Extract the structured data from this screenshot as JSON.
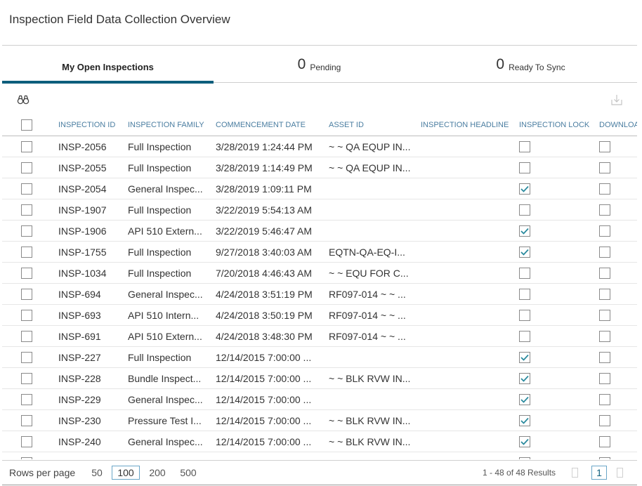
{
  "page": {
    "title": "Inspection Field Data Collection Overview"
  },
  "tabs": {
    "my_open": {
      "label": "My Open Inspections"
    },
    "pending": {
      "count": "0",
      "label": "Pending"
    },
    "ready": {
      "count": "0",
      "label": "Ready To Sync"
    }
  },
  "toolbar": {
    "search_icon": "binoculars-icon",
    "download_icon": "download-icon"
  },
  "columns": {
    "id": "INSPECTION ID",
    "family": "INSPECTION FAMILY",
    "date": "COMMENCEMENT DATE",
    "asset": "ASSET ID",
    "headline": "INSPECTION HEADLINE",
    "lock": "INSPECTION LOCK",
    "download": "DOWNLOA"
  },
  "rows": [
    {
      "id": "INSP-2056",
      "family": "Full Inspection",
      "date": "3/28/2019 1:24:44 PM",
      "asset": "~ ~ QA EQUP IN...",
      "headline": "",
      "lock": false,
      "download": false
    },
    {
      "id": "INSP-2055",
      "family": "Full Inspection",
      "date": "3/28/2019 1:14:49 PM",
      "asset": "~ ~ QA EQUP IN...",
      "headline": "",
      "lock": false,
      "download": false
    },
    {
      "id": "INSP-2054",
      "family": "General Inspec...",
      "date": "3/28/2019 1:09:11 PM",
      "asset": "",
      "headline": "",
      "lock": true,
      "download": false
    },
    {
      "id": "INSP-1907",
      "family": "Full Inspection",
      "date": "3/22/2019 5:54:13 AM",
      "asset": "",
      "headline": "",
      "lock": false,
      "download": false
    },
    {
      "id": "INSP-1906",
      "family": "API 510 Extern...",
      "date": "3/22/2019 5:46:47 AM",
      "asset": "",
      "headline": "",
      "lock": true,
      "download": false
    },
    {
      "id": "INSP-1755",
      "family": "Full Inspection",
      "date": "9/27/2018 3:40:03 AM",
      "asset": "EQTN-QA-EQ-I...",
      "headline": "",
      "lock": true,
      "download": false
    },
    {
      "id": "INSP-1034",
      "family": "Full Inspection",
      "date": "7/20/2018 4:46:43 AM",
      "asset": "~ ~ EQU FOR C...",
      "headline": "",
      "lock": false,
      "download": false
    },
    {
      "id": "INSP-694",
      "family": "General Inspec...",
      "date": "4/24/2018 3:51:19 PM",
      "asset": "RF097-014 ~ ~ ...",
      "headline": "",
      "lock": false,
      "download": false
    },
    {
      "id": "INSP-693",
      "family": "API 510 Intern...",
      "date": "4/24/2018 3:50:19 PM",
      "asset": "RF097-014 ~ ~ ...",
      "headline": "",
      "lock": false,
      "download": false
    },
    {
      "id": "INSP-691",
      "family": "API 510 Extern...",
      "date": "4/24/2018 3:48:30 PM",
      "asset": "RF097-014 ~ ~ ...",
      "headline": "",
      "lock": false,
      "download": false
    },
    {
      "id": "INSP-227",
      "family": "Full Inspection",
      "date": "12/14/2015 7:00:00 ...",
      "asset": "",
      "headline": "",
      "lock": true,
      "download": false
    },
    {
      "id": "INSP-228",
      "family": "Bundle Inspect...",
      "date": "12/14/2015 7:00:00 ...",
      "asset": "~ ~ BLK RVW IN...",
      "headline": "",
      "lock": true,
      "download": false
    },
    {
      "id": "INSP-229",
      "family": "General Inspec...",
      "date": "12/14/2015 7:00:00 ...",
      "asset": "",
      "headline": "",
      "lock": true,
      "download": false
    },
    {
      "id": "INSP-230",
      "family": "Pressure Test I...",
      "date": "12/14/2015 7:00:00 ...",
      "asset": "~ ~ BLK RVW IN...",
      "headline": "",
      "lock": true,
      "download": false
    },
    {
      "id": "INSP-240",
      "family": "General Inspec...",
      "date": "12/14/2015 7:00:00 ...",
      "asset": "~ ~ BLK RVW IN...",
      "headline": "",
      "lock": true,
      "download": false
    },
    {
      "id": "",
      "family": "",
      "date": "",
      "asset": "",
      "headline": "",
      "lock": true,
      "download": false
    }
  ],
  "footer": {
    "rows_per_page_label": "Rows per page",
    "page_sizes": [
      "50",
      "100",
      "200",
      "500"
    ],
    "active_page_size": "100",
    "results": "1 - 48 of 48 Results",
    "current_page": "1"
  },
  "colors": {
    "accent": "#0d5e7c",
    "header_text": "#4a7da0",
    "check": "#2a8a9e"
  }
}
